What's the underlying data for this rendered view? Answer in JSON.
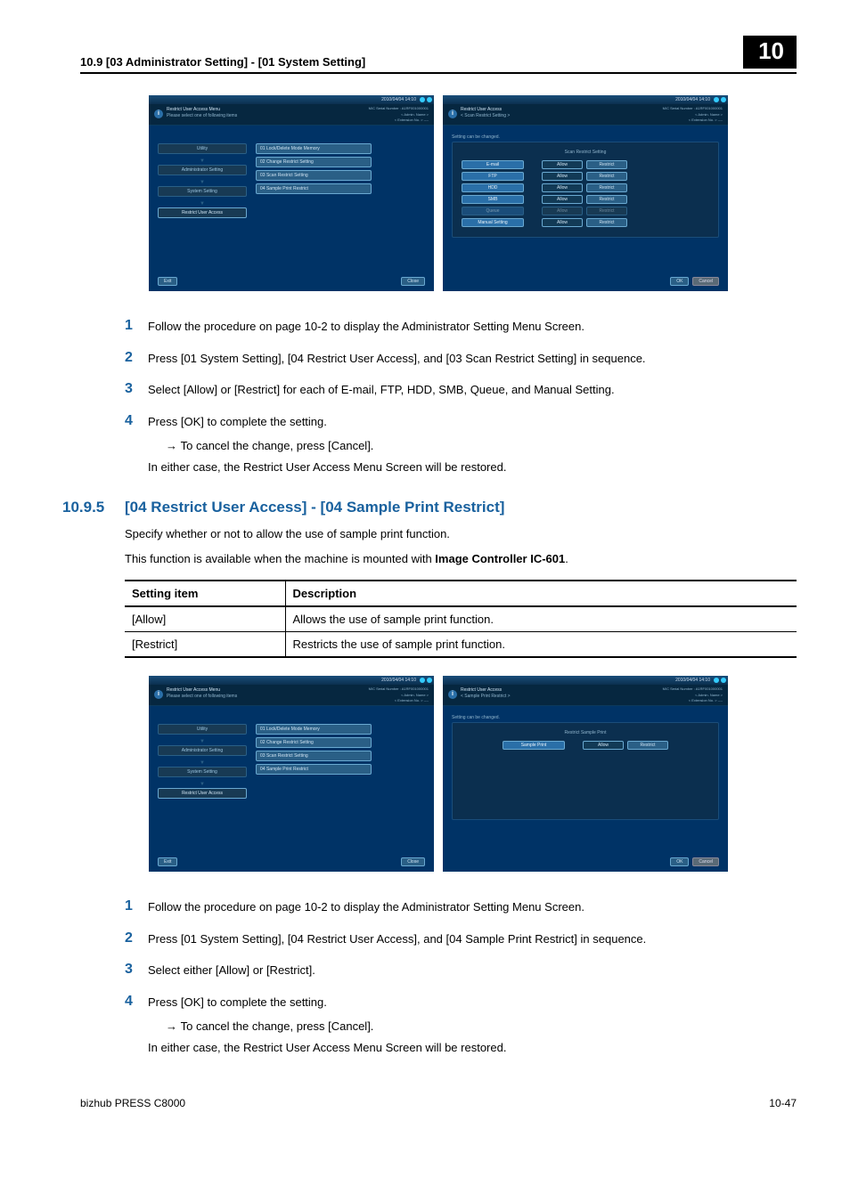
{
  "header": {
    "section_title": "10.9    [03 Administrator Setting] - [01 System Setting]",
    "chapter_number": "10"
  },
  "screenshot_common": {
    "timestamp": "2010/04/04 14:10",
    "serial": "M/C Serial Number : A1RF001000001",
    "admin": "< Admin. Name >",
    "ext": "< Extension No. >  ----"
  },
  "screenshot_a": {
    "title1": "Restrict User Access Menu",
    "title2": "Please select one of following items",
    "nav": [
      "Utility",
      "Administrator Setting",
      "System Setting",
      "Restrict User Access"
    ],
    "menu": [
      "01 Lock/Delete Mode Memory",
      "02 Change Restrict Setting",
      "03 Scan Restrict Setting",
      "04 Sample Print Restrict"
    ],
    "exit": "Exit",
    "close": "Close"
  },
  "screenshot_b": {
    "title1": "Restrict User Access",
    "title2": "< Scan Restrict Setting >",
    "changed": "Setting can be changed.",
    "panel_title": "Scan Restrict Setting",
    "rows": [
      {
        "label": "E-mail",
        "allow": "Allow",
        "restrict": "Restrict"
      },
      {
        "label": "FTP",
        "allow": "Allow",
        "restrict": "Restrict"
      },
      {
        "label": "HDD",
        "allow": "Allow",
        "restrict": "Restrict"
      },
      {
        "label": "SMB",
        "allow": "Allow",
        "restrict": "Restrict"
      },
      {
        "label": "Queue",
        "allow": "Allow",
        "restrict": "Restrict",
        "disabled": true
      },
      {
        "label": "Manual Setting",
        "allow": "Allow",
        "restrict": "Restrict"
      }
    ],
    "cancel": "Cancel",
    "ok": "OK"
  },
  "steps_1": [
    "Follow the procedure on page 10-2 to display the Administrator Setting Menu Screen.",
    "Press [01 System Setting], [04 Restrict User Access], and [03 Scan Restrict Setting] in sequence.",
    "Select [Allow] or [Restrict] for each of E-mail, FTP, HDD, SMB, Queue, and Manual Setting.",
    "Press [OK] to complete the setting."
  ],
  "steps_1_sub": {
    "arrow": "To cancel the change, press [Cancel].",
    "line": "In either case, the Restrict User Access Menu Screen will be restored."
  },
  "section_1095": {
    "num": "10.9.5",
    "title": "[04 Restrict User Access] - [04 Sample Print Restrict]",
    "para1": "Specify whether or not to allow the use of sample print function.",
    "para2_pre": "This function is available when the machine is mounted with ",
    "para2_bold": "Image Controller IC-601",
    "para2_post": "."
  },
  "table": {
    "head1": "Setting item",
    "head2": "Description",
    "rows": [
      {
        "item": "[Allow]",
        "desc": "Allows the use of sample print function."
      },
      {
        "item": "[Restrict]",
        "desc": "Restricts the use of sample print function."
      }
    ]
  },
  "screenshot_d": {
    "title1": "Restrict User Access",
    "title2": "< Sample Print Restrict >",
    "changed": "Setting can be changed.",
    "panel_title": "Restrict Sample Print",
    "row": {
      "label": "Sample Print",
      "allow": "Allow",
      "restrict": "Restrict"
    },
    "cancel": "Cancel",
    "ok": "OK"
  },
  "steps_2": [
    "Follow the procedure on page 10-2 to display the Administrator Setting Menu Screen.",
    "Press [01 System Setting], [04 Restrict User Access], and [04 Sample Print Restrict] in sequence.",
    "Select either [Allow] or [Restrict].",
    "Press [OK] to complete the setting."
  ],
  "steps_2_sub": {
    "arrow": "To cancel the change, press [Cancel].",
    "line": "In either case, the Restrict User Access Menu Screen will be restored."
  },
  "footer": {
    "product": "bizhub PRESS C8000",
    "page": "10-47"
  }
}
